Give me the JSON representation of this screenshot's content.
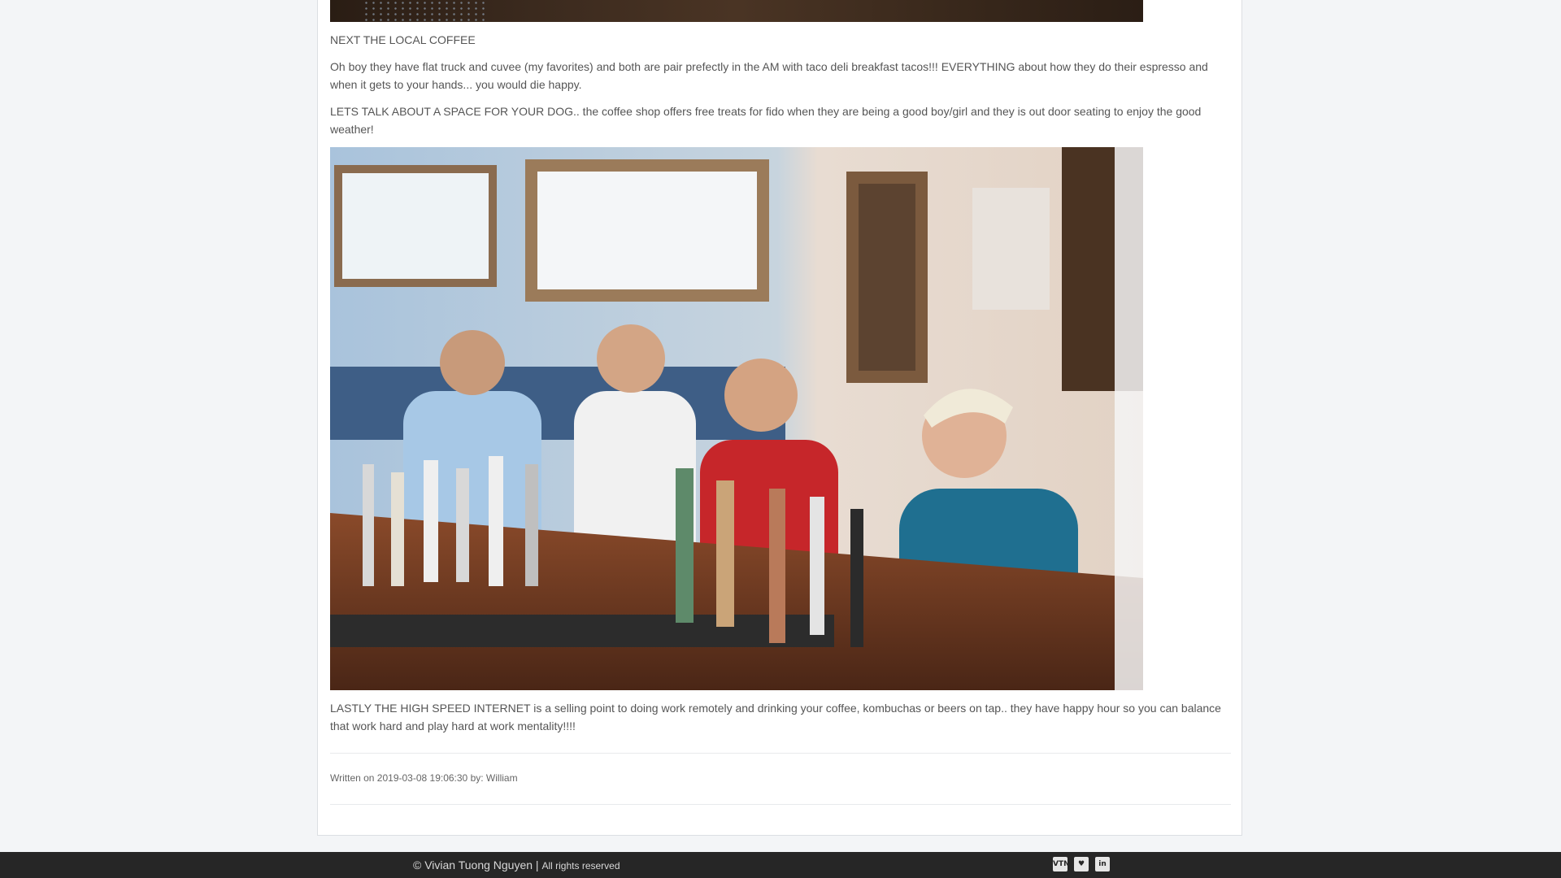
{
  "post": {
    "heading_coffee": "NEXT THE LOCAL COFFEE",
    "para_coffee": "Oh boy they have flat truck and cuvee (my favorites) and both are pair prefectly in the AM with taco deli breakfast tacos!!! EVERYTHING about how they do their espresso and when it gets to your hands... you would die happy.",
    "para_dog": "LETS TALK ABOUT A SPACE FOR  YOUR DOG.. the coffee shop offers free treats for fido when they are being a good boy/girl and they is out door seating to enjoy the good weather!",
    "para_internet": "LASTLY THE HIGH SPEED INTERNET is a selling point to doing work remotely and drinking your coffee, kombuchas  or beers on tap.. they have happy hour so you can balance that work hard and play hard at work mentality!!!!",
    "meta": "Written on 2019-03-08 19:06:30 by: William"
  },
  "footer": {
    "copyright": "© Vivian Tuong Nguyen | ",
    "rights": "All rights reserved",
    "social": [
      {
        "icon": "vtn-logo-icon",
        "label": "VTN"
      },
      {
        "icon": "heart-shield-icon",
        "label": "♥"
      },
      {
        "icon": "linkedin-icon",
        "label": "in"
      }
    ]
  }
}
